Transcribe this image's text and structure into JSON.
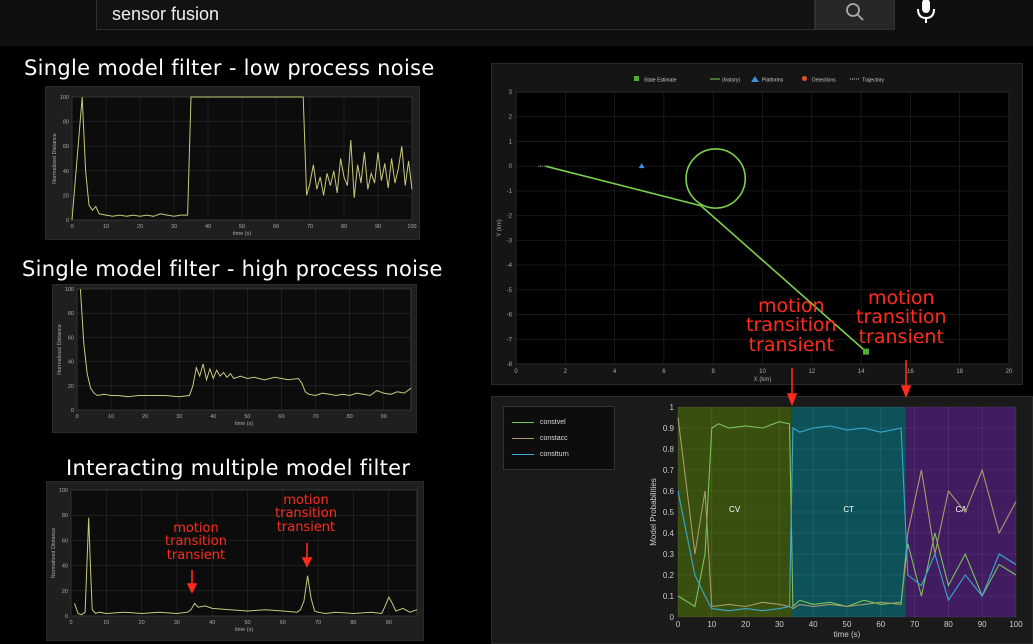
{
  "search": {
    "query": "sensor fusion",
    "search_icon": "search-icon",
    "mic_icon": "microphone-icon"
  },
  "titles": {
    "low_noise": "Single model filter - low process noise",
    "high_noise": "Single model filter - high process noise",
    "imm": "Interacting multiple model filter"
  },
  "annotations": {
    "transient_line1": "motion",
    "transient_line2": "transition",
    "transient_line3": "transient"
  },
  "colors": {
    "signal": "#c8c87a",
    "annotation": "#ff2b1c",
    "trajectory": "#7ccf4a",
    "platform": "#3b8fe0",
    "cv_region": "#3f5a10",
    "ct_region": "#0e5e66",
    "ca_region": "#4a1f6e",
    "constvel": "#7ac25a",
    "constacc": "#a89a6a",
    "constturn": "#3aa8d0"
  },
  "chart_data": [
    {
      "type": "line",
      "name": "low_noise",
      "xlabel": "time (s)",
      "ylabel": "Normalized Distance",
      "xlim": [
        0,
        100
      ],
      "ylim": [
        0,
        100
      ],
      "xticks": [
        0,
        10,
        20,
        30,
        40,
        50,
        60,
        70,
        80,
        90,
        100
      ],
      "yticks": [
        0,
        20,
        40,
        60,
        80,
        100
      ],
      "x": [
        0,
        3,
        4,
        5,
        6,
        7,
        8,
        10,
        12,
        14,
        16,
        18,
        20,
        22,
        24,
        26,
        28,
        30,
        32,
        34,
        35,
        68,
        69,
        70,
        71,
        72,
        73,
        74,
        75,
        76,
        77,
        78,
        79,
        80,
        81,
        82,
        83,
        84,
        85,
        86,
        87,
        88,
        89,
        90,
        91,
        92,
        93,
        94,
        95,
        96,
        97,
        98,
        99,
        100
      ],
      "y": [
        0,
        100,
        40,
        12,
        8,
        11,
        5,
        4,
        3,
        4,
        3,
        4,
        3,
        4,
        3,
        5,
        4,
        3,
        4,
        4,
        100,
        100,
        20,
        30,
        45,
        25,
        35,
        20,
        38,
        28,
        40,
        22,
        50,
        35,
        28,
        65,
        18,
        45,
        30,
        55,
        25,
        38,
        30,
        55,
        32,
        46,
        26,
        50,
        30,
        42,
        60,
        28,
        48,
        25
      ]
    },
    {
      "type": "line",
      "name": "high_noise",
      "xlabel": "time (s)",
      "ylabel": "Normalized Distance",
      "xlim": [
        0,
        98
      ],
      "ylim": [
        0,
        100
      ],
      "xticks": [
        0,
        10,
        20,
        30,
        40,
        50,
        60,
        70,
        80,
        90
      ],
      "yticks": [
        0,
        20,
        40,
        60,
        80,
        100
      ],
      "x": [
        1,
        2,
        3,
        4,
        5,
        6,
        8,
        10,
        12,
        15,
        18,
        22,
        26,
        30,
        33,
        34,
        35,
        36,
        37,
        38,
        39,
        40,
        41,
        42,
        43,
        44,
        45,
        46,
        48,
        50,
        52,
        55,
        58,
        60,
        62,
        65,
        66,
        67,
        68,
        70,
        72,
        74,
        76,
        78,
        80,
        82,
        84,
        86,
        88,
        90,
        92,
        94,
        96,
        98
      ],
      "y": [
        100,
        55,
        30,
        18,
        14,
        12,
        13,
        12,
        12,
        11,
        12,
        12,
        12,
        11,
        12,
        20,
        35,
        28,
        38,
        25,
        34,
        26,
        33,
        28,
        31,
        27,
        30,
        26,
        28,
        26,
        27,
        25,
        27,
        26,
        25,
        26,
        22,
        15,
        13,
        12,
        14,
        13,
        12,
        13,
        12,
        14,
        13,
        12,
        16,
        14,
        13,
        15,
        14,
        18
      ]
    },
    {
      "type": "line",
      "name": "imm",
      "xlabel": "time (s)",
      "ylabel": "Normalized Distance",
      "xlim": [
        0,
        98
      ],
      "ylim": [
        0,
        100
      ],
      "xticks": [
        0,
        10,
        20,
        30,
        40,
        50,
        60,
        70,
        80,
        90
      ],
      "yticks": [
        0,
        20,
        40,
        60,
        80,
        100
      ],
      "x": [
        1,
        2,
        3,
        4,
        4.5,
        5,
        5.5,
        6,
        7,
        8,
        10,
        15,
        20,
        25,
        30,
        33,
        34,
        35,
        36,
        38,
        40,
        45,
        50,
        55,
        60,
        64,
        65,
        66,
        67,
        68,
        69,
        70,
        72,
        75,
        80,
        85,
        88,
        89,
        90,
        91,
        92,
        94,
        96,
        98
      ],
      "y": [
        10,
        2,
        1,
        3,
        40,
        78,
        40,
        5,
        2,
        3,
        2,
        3,
        2,
        3,
        2,
        3,
        5,
        10,
        7,
        8,
        6,
        5,
        4,
        5,
        4,
        3,
        5,
        12,
        32,
        14,
        4,
        3,
        2,
        3,
        2,
        3,
        2,
        8,
        15,
        10,
        4,
        6,
        3,
        5
      ]
    },
    {
      "type": "line",
      "name": "trajectory",
      "xlabel": "X (km)",
      "ylabel": "Y (km)",
      "xlim": [
        0,
        20
      ],
      "ylim": [
        -8,
        3
      ],
      "xticks": [
        0,
        2,
        4,
        6,
        8,
        10,
        12,
        14,
        16,
        18,
        20
      ],
      "yticks": [
        3,
        2,
        1,
        0,
        -1,
        -2,
        -3,
        -4,
        -5,
        -6,
        -7,
        -8
      ],
      "legend": [
        "State Estimate",
        "(history)",
        "Platforms",
        "Detections",
        "Trajectory"
      ],
      "track_x": [
        1.2,
        7.5,
        14.2
      ],
      "track_y": [
        0,
        -1.6,
        -7.5
      ],
      "circle_center": [
        8.1,
        -0.5
      ],
      "circle_radius_km": 1.2,
      "platform": [
        5.1,
        0
      ],
      "estimate": [
        14.2,
        -7.5
      ]
    },
    {
      "type": "area",
      "name": "model_probabilities",
      "xlabel": "time (s)",
      "ylabel": "Model Probabilities",
      "xlim": [
        0,
        100
      ],
      "ylim": [
        0,
        1
      ],
      "xticks": [
        0,
        10,
        20,
        30,
        40,
        50,
        60,
        70,
        80,
        90,
        100
      ],
      "yticks": [
        0,
        0.1,
        0.2,
        0.3,
        0.4,
        0.5,
        0.6,
        0.7,
        0.8,
        0.9,
        1
      ],
      "regions": [
        {
          "label": "CV",
          "x0": 0,
          "x1": 33.5
        },
        {
          "label": "CT",
          "x0": 33.5,
          "x1": 67.5
        },
        {
          "label": "CA",
          "x0": 67.5,
          "x1": 100
        }
      ],
      "legend": [
        "constvel",
        "constacc",
        "constturn"
      ],
      "series": [
        {
          "name": "constvel",
          "x": [
            0,
            5,
            8,
            10,
            12,
            15,
            20,
            25,
            30,
            33,
            34,
            36,
            40,
            45,
            50,
            55,
            60,
            66,
            68,
            72,
            76,
            80,
            85,
            90,
            95,
            100
          ],
          "y": [
            0.1,
            0.05,
            0.3,
            0.9,
            0.92,
            0.9,
            0.91,
            0.9,
            0.93,
            0.92,
            0.05,
            0.08,
            0.06,
            0.07,
            0.05,
            0.08,
            0.06,
            0.07,
            0.35,
            0.1,
            0.4,
            0.15,
            0.3,
            0.1,
            0.25,
            0.2
          ]
        },
        {
          "name": "constacc",
          "x": [
            0,
            5,
            8,
            10,
            15,
            20,
            25,
            30,
            33,
            34,
            36,
            40,
            45,
            50,
            55,
            60,
            66,
            68,
            72,
            76,
            80,
            85,
            90,
            95,
            100
          ],
          "y": [
            0.95,
            0.3,
            0.6,
            0.05,
            0.06,
            0.05,
            0.07,
            0.06,
            0.05,
            0.04,
            0.06,
            0.05,
            0.06,
            0.05,
            0.06,
            0.07,
            0.06,
            0.4,
            0.7,
            0.3,
            0.6,
            0.5,
            0.7,
            0.4,
            0.55
          ]
        },
        {
          "name": "constturn",
          "x": [
            0,
            5,
            8,
            10,
            15,
            20,
            25,
            30,
            33,
            34,
            36,
            40,
            45,
            50,
            55,
            60,
            66,
            68,
            72,
            76,
            80,
            85,
            90,
            95,
            100
          ],
          "y": [
            0.6,
            0.2,
            0.1,
            0.04,
            0.03,
            0.04,
            0.03,
            0.04,
            0.05,
            0.9,
            0.88,
            0.9,
            0.91,
            0.89,
            0.9,
            0.88,
            0.9,
            0.2,
            0.15,
            0.3,
            0.08,
            0.2,
            0.1,
            0.3,
            0.25
          ]
        }
      ]
    }
  ]
}
